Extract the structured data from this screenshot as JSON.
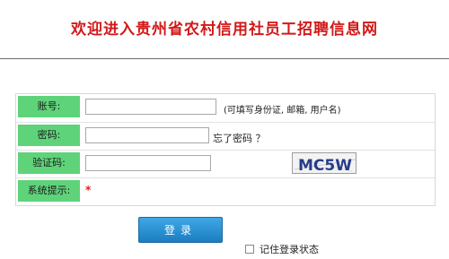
{
  "page": {
    "title": "欢迎进入贵州省农村信用社员工招聘信息网"
  },
  "form": {
    "account": {
      "label": "账号:",
      "value": "",
      "hint": "(可填写身份证, 邮箱, 用户名)"
    },
    "password": {
      "label": "密码:",
      "value": "",
      "forgot": "忘了密码 ？"
    },
    "captcha": {
      "label": "验证码:",
      "value": "",
      "code": "MC5W"
    },
    "system": {
      "label": "系统提示:",
      "required": "*"
    },
    "login_label": "登录",
    "remember_label": "记住登录状态"
  }
}
